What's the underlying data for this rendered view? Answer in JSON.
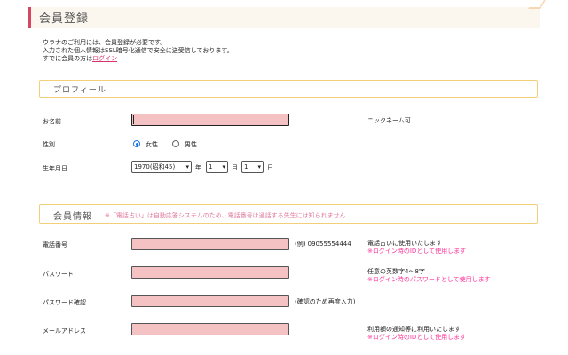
{
  "header": {
    "title": "会員登録"
  },
  "intro": {
    "line1": "ウラナのご利用には、会員登録が必要です。",
    "line2": "入力された個人情報はSSL暗号化通信で安全に送受信しております。",
    "line3_prefix": "すでに会員の方は",
    "login_link": "ログイン"
  },
  "profile": {
    "section_title": "プロフィール",
    "name_label": "お名前",
    "name_value": "",
    "name_note": "ニックネーム可",
    "gender_label": "性別",
    "gender_female": "女性",
    "gender_male": "男性",
    "gender_selected": "女性",
    "birthday_label": "生年月日",
    "birth_year": "1970(昭和45)",
    "year_unit": "年",
    "birth_month": "1",
    "month_unit": "月",
    "birth_day": "1",
    "day_unit": "日"
  },
  "member": {
    "section_title": "会員情報",
    "section_note": "※「電話占い」は自動応答システムのため、電話番号は通話する先生には知られません",
    "phone_label": "電話番号",
    "phone_value": "",
    "phone_example": "(例) 09055554444",
    "phone_note1": "電話占いに使用いたします",
    "phone_note2": "※ログイン時のIDとして使用します",
    "password_label": "パスワード",
    "password_value": "",
    "password_note1": "任意の英数字4～8字",
    "password_note2": "※ログイン時のパスワードとして使用します",
    "password_confirm_label": "パスワード確認",
    "password_confirm_value": "",
    "password_confirm_hint": "(確認のため再度入力)",
    "email_label": "メールアドレス",
    "email_value": "",
    "email_note1": "利用額の通知等に利用いたします",
    "email_note2": "※ログイン時のIDとして使用します"
  },
  "colors": {
    "accent": "#d64561",
    "input_bg": "#f4c2c2",
    "section_border": "#f2cf7a",
    "note_pink": "#ff3399",
    "header_bg": "#fbf6ee"
  }
}
